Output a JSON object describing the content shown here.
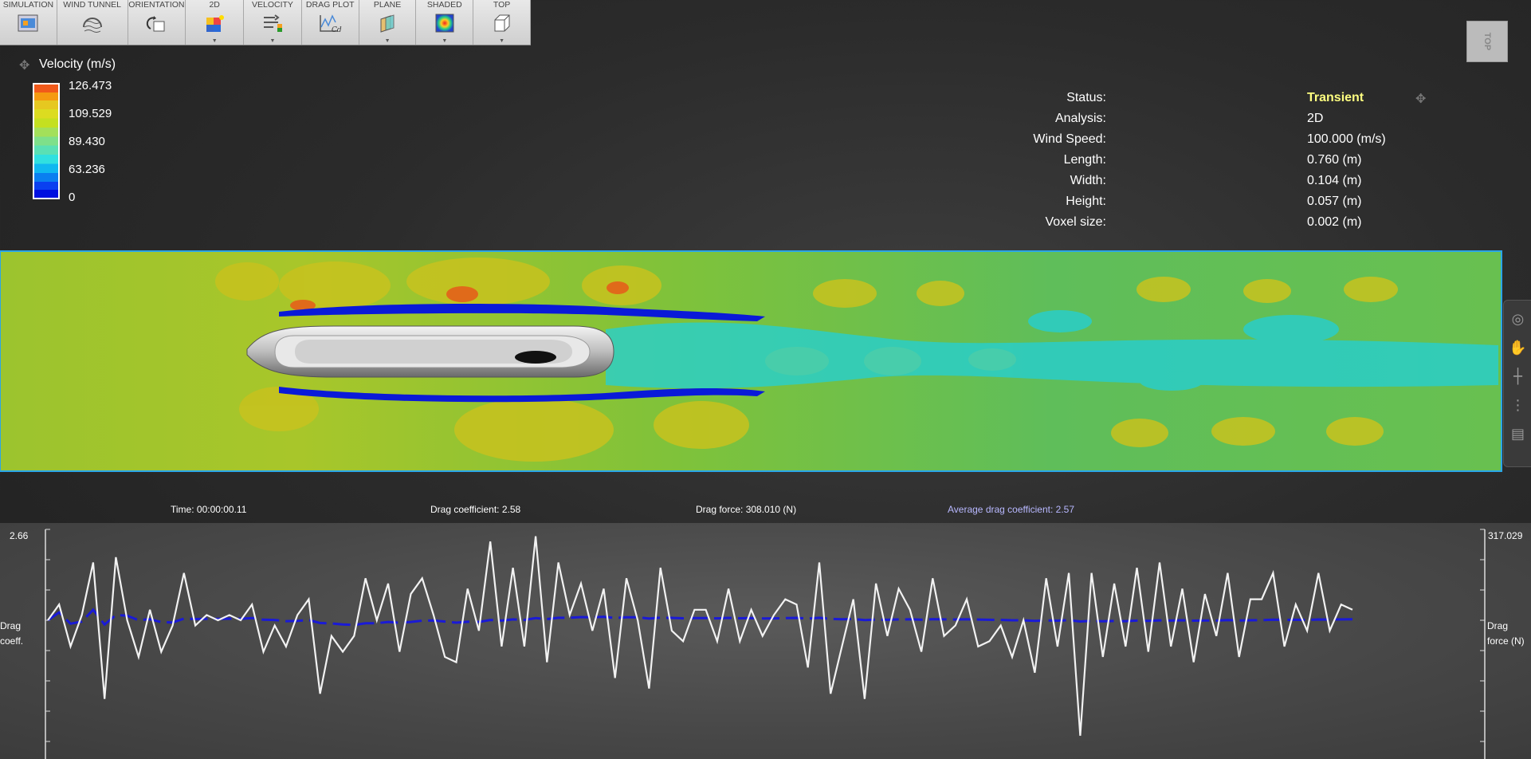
{
  "toolbar": {
    "buttons": [
      {
        "label": "SIMULATION",
        "icon": "simulation-icon"
      },
      {
        "label": "WIND TUNNEL",
        "icon": "wind-tunnel-icon"
      },
      {
        "label": "ORIENTATION",
        "icon": "orientation-icon"
      },
      {
        "label": "2D",
        "icon": "2d-icon"
      },
      {
        "label": "VELOCITY",
        "icon": "velocity-icon"
      },
      {
        "label": "DRAG PLOT",
        "icon": "drag-plot-icon"
      },
      {
        "label": "PLANE",
        "icon": "plane-icon"
      },
      {
        "label": "SHADED",
        "icon": "shaded-icon"
      },
      {
        "label": "TOP",
        "icon": "top-view-icon"
      }
    ]
  },
  "legend": {
    "title": "Velocity (m/s)",
    "ticks": [
      "126.473",
      "109.529",
      "89.430",
      "63.236",
      "0"
    ]
  },
  "info": {
    "status_label": "Status:",
    "status_value": "Transient",
    "analysis_label": "Analysis:",
    "analysis_value": "2D",
    "wind_label": "Wind Speed:",
    "wind_value": "100.000 (m/s)",
    "length_label": "Length:",
    "length_value": "0.760 (m)",
    "width_label": "Width:",
    "width_value": "0.104 (m)",
    "height_label": "Height:",
    "height_value": "0.057 (m)",
    "voxel_label": "Voxel size:",
    "voxel_value": "0.002 (m)"
  },
  "view_cube": {
    "label": "TOP"
  },
  "readouts": {
    "time": "Time: 00:00:00.11",
    "drag_coefficient": "Drag coefficient: 2.58",
    "drag_force": "Drag force: 308.010 (N)",
    "average_drag": "Average drag coefficient: 2.57"
  },
  "plot": {
    "left_max": "2.66",
    "right_max": "317.029",
    "left_axis_label_1": "Drag",
    "left_axis_label_2": "coeff.",
    "right_axis_label_1": "Drag",
    "right_axis_label_2": "force (N)",
    "drag_series": [
      2.49,
      2.52,
      2.44,
      2.5,
      2.6,
      2.34,
      2.61,
      2.49,
      2.42,
      2.51,
      2.43,
      2.48,
      2.58,
      2.48,
      2.5,
      2.49,
      2.5,
      2.49,
      2.52,
      2.43,
      2.48,
      2.44,
      2.5,
      2.53,
      2.35,
      2.46,
      2.43,
      2.46,
      2.57,
      2.49,
      2.56,
      2.43,
      2.54,
      2.57,
      2.5,
      2.42,
      2.41,
      2.55,
      2.47,
      2.64,
      2.44,
      2.59,
      2.44,
      2.65,
      2.41,
      2.6,
      2.5,
      2.56,
      2.47,
      2.55,
      2.38,
      2.57,
      2.49,
      2.36,
      2.59,
      2.47,
      2.45,
      2.51,
      2.51,
      2.45,
      2.55,
      2.45,
      2.51,
      2.46,
      2.5,
      2.53,
      2.52,
      2.4,
      2.6,
      2.35,
      2.44,
      2.53,
      2.34,
      2.56,
      2.46,
      2.55,
      2.51,
      2.43,
      2.57,
      2.46,
      2.48,
      2.53,
      2.44,
      2.45,
      2.48,
      2.42,
      2.49,
      2.39,
      2.57,
      2.44,
      2.58,
      2.27,
      2.58,
      2.42,
      2.56,
      2.44,
      2.59,
      2.43,
      2.6,
      2.44,
      2.55,
      2.41,
      2.54,
      2.46,
      2.58,
      2.42,
      2.53,
      2.53,
      2.58,
      2.44,
      2.52,
      2.47,
      2.58,
      2.47,
      2.52,
      2.51
    ]
  },
  "colors": {
    "drag_line": "#f2f2f2",
    "average_line": "#1a1ad6",
    "status": "#ffff80",
    "average_text": "#b8b8ff"
  }
}
